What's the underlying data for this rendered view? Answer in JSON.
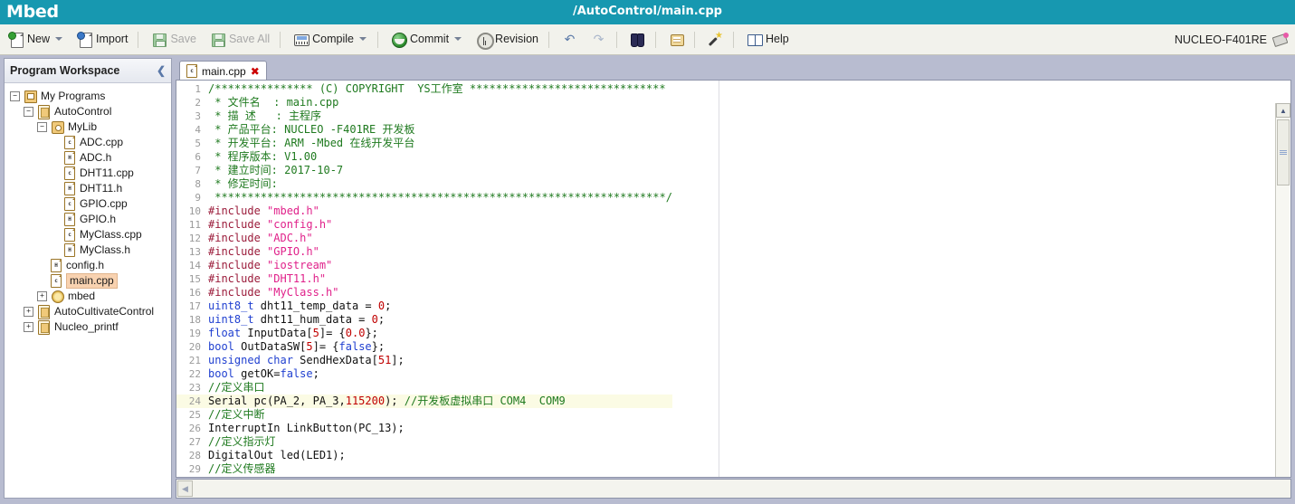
{
  "window": {
    "brand": "Mbed",
    "document_title": "/AutoControl/main.cpp",
    "accent_color": "#1798b0"
  },
  "toolbar": {
    "items": [
      {
        "label": "New",
        "icon": "new-page-icon",
        "caret": true,
        "disabled": false
      },
      {
        "label": "Import",
        "icon": "import-page-icon",
        "caret": false,
        "disabled": false
      },
      {
        "label": "Save",
        "icon": "save-floppy-icon",
        "caret": false,
        "disabled": true
      },
      {
        "label": "Save All",
        "icon": "save-all-floppy-icon",
        "caret": false,
        "disabled": true
      },
      {
        "label": "Compile",
        "icon": "compile-icon",
        "caret": true,
        "disabled": false
      },
      {
        "label": "Commit",
        "icon": "commit-globe-icon",
        "caret": true,
        "disabled": false
      },
      {
        "label": "Revision",
        "icon": "revision-clock-icon",
        "caret": false,
        "disabled": false
      },
      {
        "label": "Help",
        "icon": "help-book-icon",
        "caret": false,
        "disabled": false
      }
    ],
    "undo_label": "↶",
    "redo_label": "↷",
    "target_device": "NUCLEO-F401RE"
  },
  "sidebar": {
    "title": "Program Workspace",
    "collapse_glyph": "❮",
    "tree": [
      {
        "label": "My Programs",
        "depth": 0,
        "icon": "programs-icon",
        "expander": "−",
        "selected": false
      },
      {
        "label": "AutoControl",
        "depth": 1,
        "icon": "project-icon",
        "expander": "−",
        "selected": false
      },
      {
        "label": "MyLib",
        "depth": 2,
        "icon": "library-icon",
        "expander": "−",
        "selected": false
      },
      {
        "label": "ADC.cpp",
        "depth": 3,
        "icon": "cpp-file-icon",
        "expander": "",
        "selected": false,
        "badge": "c"
      },
      {
        "label": "ADC.h",
        "depth": 3,
        "icon": "h-file-icon",
        "expander": "",
        "selected": false,
        "badge": "H"
      },
      {
        "label": "DHT11.cpp",
        "depth": 3,
        "icon": "cpp-file-icon",
        "expander": "",
        "selected": false,
        "badge": "c"
      },
      {
        "label": "DHT11.h",
        "depth": 3,
        "icon": "h-file-icon",
        "expander": "",
        "selected": false,
        "badge": "H"
      },
      {
        "label": "GPIO.cpp",
        "depth": 3,
        "icon": "cpp-file-icon",
        "expander": "",
        "selected": false,
        "badge": "c"
      },
      {
        "label": "GPIO.h",
        "depth": 3,
        "icon": "h-file-icon",
        "expander": "",
        "selected": false,
        "badge": "H"
      },
      {
        "label": "MyClass.cpp",
        "depth": 3,
        "icon": "cpp-file-icon",
        "expander": "",
        "selected": false,
        "badge": "c"
      },
      {
        "label": "MyClass.h",
        "depth": 3,
        "icon": "h-file-icon",
        "expander": "",
        "selected": false,
        "badge": "H"
      },
      {
        "label": "config.h",
        "depth": 2,
        "icon": "h-file-icon",
        "expander": "",
        "selected": false,
        "badge": "H"
      },
      {
        "label": "main.cpp",
        "depth": 2,
        "icon": "cpp-file-icon",
        "expander": "",
        "selected": true,
        "badge": "c"
      },
      {
        "label": "mbed",
        "depth": 2,
        "icon": "mbed-gear-icon",
        "expander": "+",
        "selected": false
      },
      {
        "label": "AutoCultivateControl",
        "depth": 1,
        "icon": "project-icon",
        "expander": "+",
        "selected": false
      },
      {
        "label": "Nucleo_printf",
        "depth": 1,
        "icon": "project-icon",
        "expander": "+",
        "selected": false
      }
    ]
  },
  "editor": {
    "tab": {
      "label": "main.cpp",
      "close_glyph": "✖",
      "icon": "cpp-file-icon",
      "badge": "c"
    },
    "active_line": 24,
    "lines": [
      {
        "n": 1,
        "tokens": [
          {
            "t": "cm",
            "v": "/*************** (C) COPYRIGHT  YS工作室 ******************************"
          }
        ]
      },
      {
        "n": 2,
        "tokens": [
          {
            "t": "cm",
            "v": " * 文件名  : main.cpp"
          }
        ]
      },
      {
        "n": 3,
        "tokens": [
          {
            "t": "cm",
            "v": " * 描 述   : 主程序"
          }
        ]
      },
      {
        "n": 4,
        "tokens": [
          {
            "t": "cm",
            "v": " * 产品平台: NUCLEO -F401RE 开发板"
          }
        ]
      },
      {
        "n": 5,
        "tokens": [
          {
            "t": "cm",
            "v": " * 开发平台: ARM -Mbed 在线开发平台"
          }
        ]
      },
      {
        "n": 6,
        "tokens": [
          {
            "t": "cm",
            "v": " * 程序版本: V1.00"
          }
        ]
      },
      {
        "n": 7,
        "tokens": [
          {
            "t": "cm",
            "v": " * 建立时间: 2017-10-7"
          }
        ]
      },
      {
        "n": 8,
        "tokens": [
          {
            "t": "cm",
            "v": " * 修定时间:"
          }
        ]
      },
      {
        "n": 9,
        "tokens": [
          {
            "t": "cm",
            "v": " *********************************************************************/"
          }
        ]
      },
      {
        "n": 10,
        "tokens": [
          {
            "t": "pp",
            "v": "#include "
          },
          {
            "t": "str",
            "v": "\"mbed.h\""
          }
        ]
      },
      {
        "n": 11,
        "tokens": [
          {
            "t": "pp",
            "v": "#include "
          },
          {
            "t": "str",
            "v": "\"config.h\""
          }
        ]
      },
      {
        "n": 12,
        "tokens": [
          {
            "t": "pp",
            "v": "#include "
          },
          {
            "t": "str",
            "v": "\"ADC.h\""
          }
        ]
      },
      {
        "n": 13,
        "tokens": [
          {
            "t": "pp",
            "v": "#include "
          },
          {
            "t": "str",
            "v": "\"GPIO.h\""
          }
        ]
      },
      {
        "n": 14,
        "tokens": [
          {
            "t": "pp",
            "v": "#include "
          },
          {
            "t": "str",
            "v": "\"iostream\""
          }
        ]
      },
      {
        "n": 15,
        "tokens": [
          {
            "t": "pp",
            "v": "#include "
          },
          {
            "t": "str",
            "v": "\"DHT11.h\""
          }
        ]
      },
      {
        "n": 16,
        "tokens": [
          {
            "t": "pp",
            "v": "#include "
          },
          {
            "t": "str",
            "v": "\"MyClass.h\""
          }
        ]
      },
      {
        "n": 17,
        "tokens": [
          {
            "t": "kw",
            "v": "uint8_t"
          },
          {
            "t": "pl",
            "v": " dht11_temp_data = "
          },
          {
            "t": "num",
            "v": "0"
          },
          {
            "t": "pl",
            "v": ";"
          }
        ]
      },
      {
        "n": 18,
        "tokens": [
          {
            "t": "kw",
            "v": "uint8_t"
          },
          {
            "t": "pl",
            "v": " dht11_hum_data = "
          },
          {
            "t": "num",
            "v": "0"
          },
          {
            "t": "pl",
            "v": ";"
          }
        ]
      },
      {
        "n": 19,
        "tokens": [
          {
            "t": "kw",
            "v": "float"
          },
          {
            "t": "pl",
            "v": " InputData["
          },
          {
            "t": "num",
            "v": "5"
          },
          {
            "t": "pl",
            "v": "]= {"
          },
          {
            "t": "num",
            "v": "0.0"
          },
          {
            "t": "pl",
            "v": "};"
          }
        ]
      },
      {
        "n": 20,
        "tokens": [
          {
            "t": "kw",
            "v": "bool"
          },
          {
            "t": "pl",
            "v": " OutDataSW["
          },
          {
            "t": "num",
            "v": "5"
          },
          {
            "t": "pl",
            "v": "]= {"
          },
          {
            "t": "kw",
            "v": "false"
          },
          {
            "t": "pl",
            "v": "};"
          }
        ]
      },
      {
        "n": 21,
        "tokens": [
          {
            "t": "kw",
            "v": "unsigned char"
          },
          {
            "t": "pl",
            "v": " SendHexData["
          },
          {
            "t": "num",
            "v": "51"
          },
          {
            "t": "pl",
            "v": "];"
          }
        ]
      },
      {
        "n": 22,
        "tokens": [
          {
            "t": "kw",
            "v": "bool"
          },
          {
            "t": "pl",
            "v": " getOK="
          },
          {
            "t": "kw",
            "v": "false"
          },
          {
            "t": "pl",
            "v": ";"
          }
        ]
      },
      {
        "n": 23,
        "tokens": [
          {
            "t": "cm",
            "v": "//定义串口"
          }
        ]
      },
      {
        "n": 24,
        "tokens": [
          {
            "t": "pl",
            "v": "Serial pc(PA_2, PA_3,"
          },
          {
            "t": "num",
            "v": "115200"
          },
          {
            "t": "pl",
            "v": "); "
          },
          {
            "t": "cm",
            "v": "//开发板虚拟串口 COM4  COM9"
          }
        ]
      },
      {
        "n": 25,
        "tokens": [
          {
            "t": "cm",
            "v": "//定义中断"
          }
        ]
      },
      {
        "n": 26,
        "tokens": [
          {
            "t": "pl",
            "v": "InterruptIn LinkButton(PC_13);"
          }
        ]
      },
      {
        "n": 27,
        "tokens": [
          {
            "t": "cm",
            "v": "//定义指示灯"
          }
        ]
      },
      {
        "n": 28,
        "tokens": [
          {
            "t": "pl",
            "v": "DigitalOut led(LED1);"
          }
        ]
      },
      {
        "n": 29,
        "tokens": [
          {
            "t": "cm",
            "v": "//定义传感器"
          }
        ]
      }
    ],
    "scroll_up_glyph": "▲",
    "scroll_down_glyph": "▼",
    "scroll_left_glyph": "◀",
    "scroll_right_glyph": "▶"
  }
}
